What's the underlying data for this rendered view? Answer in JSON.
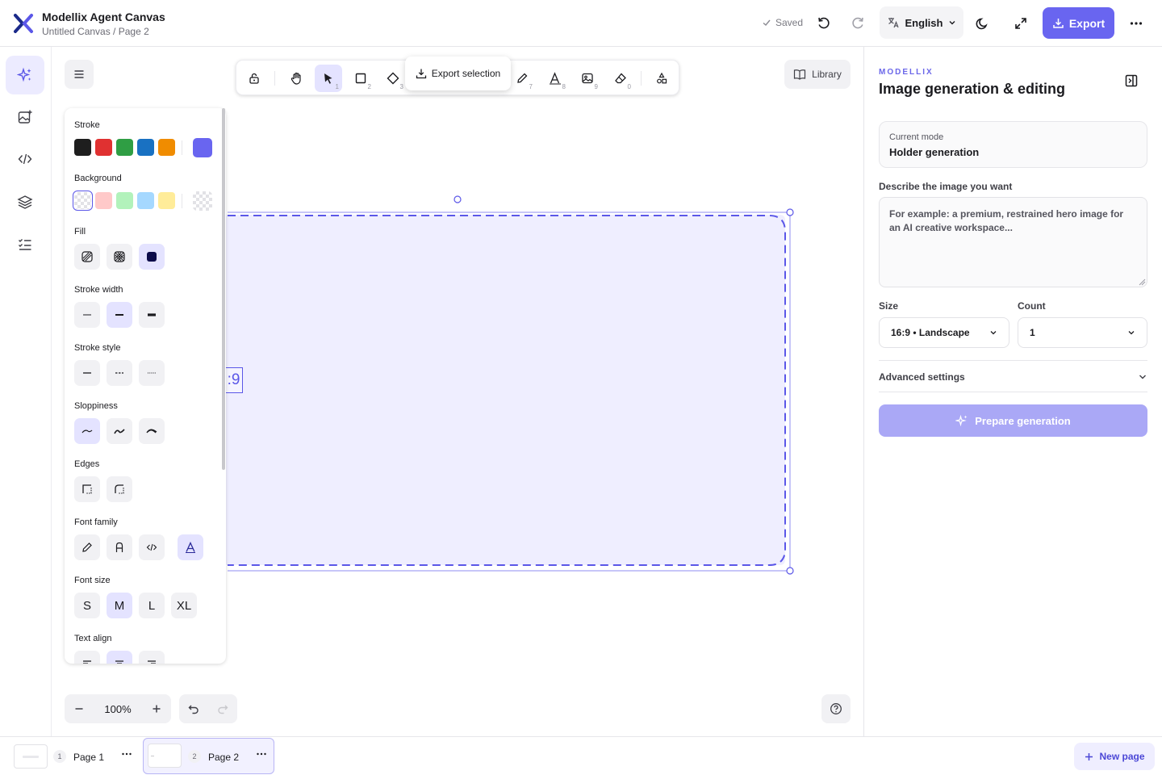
{
  "header": {
    "app_title": "Modellix Agent Canvas",
    "breadcrumb": "Untitled Canvas / Page 2",
    "saved_label": "Saved",
    "language": "English",
    "export_label": "Export"
  },
  "toolbar": {
    "export_selection_label": "Export selection",
    "library_label": "Library",
    "shortcuts": [
      "1",
      "2",
      "3",
      "7",
      "8",
      "9",
      "0"
    ]
  },
  "properties": {
    "stroke_label": "Stroke",
    "background_label": "Background",
    "fill_label": "Fill",
    "stroke_width_label": "Stroke width",
    "stroke_style_label": "Stroke style",
    "sloppiness_label": "Sloppiness",
    "edges_label": "Edges",
    "font_family_label": "Font family",
    "font_size_label": "Font size",
    "text_align_label": "Text align",
    "font_sizes": [
      "S",
      "M",
      "L",
      "XL"
    ],
    "stroke_colors": [
      "#1e1e1e",
      "#e03131",
      "#2f9e44",
      "#1971c2",
      "#f08c00"
    ],
    "stroke_current": "#6965f0",
    "background_colors": [
      "transparent",
      "#ffc9c9",
      "#b2f2bb",
      "#a5d8ff",
      "#ffec99"
    ],
    "canvas_accent": "#5b57e8",
    "shape_fill": "#efeeff"
  },
  "canvas": {
    "placeholder_text": ":9"
  },
  "zoom": {
    "value": "100%"
  },
  "pages": {
    "items": [
      {
        "number": "1",
        "name": "Page 1"
      },
      {
        "number": "2",
        "name": "Page 2"
      }
    ],
    "new_page_label": "New page"
  },
  "panel": {
    "eyebrow": "MODELLIX",
    "title": "Image generation & editing",
    "mode_label": "Current mode",
    "mode_value": "Holder generation",
    "prompt_label": "Describe the image you want",
    "prompt_placeholder": "For example: a premium, restrained hero image for an AI creative workspace...",
    "size_label": "Size",
    "size_value": "16:9 • Landscape",
    "count_label": "Count",
    "count_value": "1",
    "advanced_label": "Advanced settings",
    "prepare_label": "Prepare generation"
  }
}
